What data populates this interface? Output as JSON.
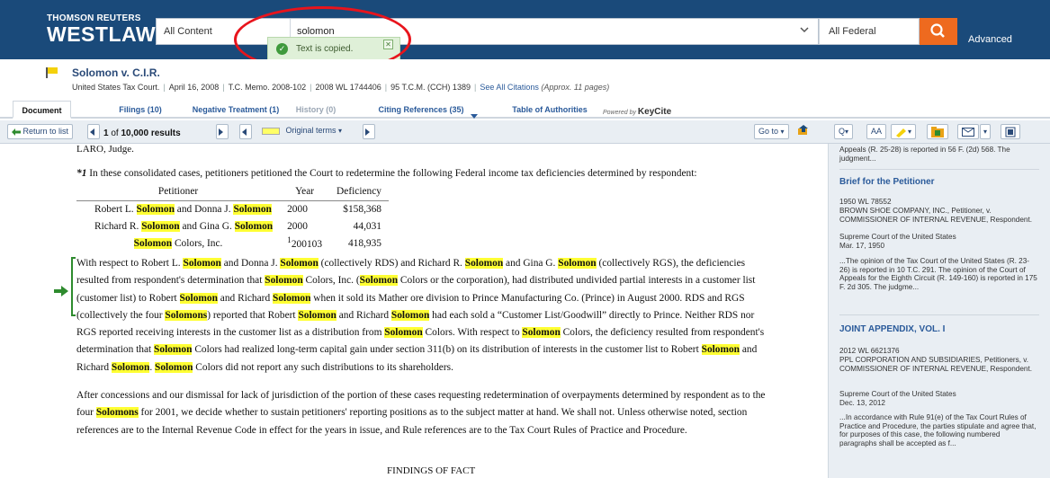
{
  "header": {
    "brand_top": "THOMSON REUTERS",
    "brand_main": "WESTLAW",
    "content_scope": "All Content",
    "query": "solomon",
    "jurisdiction": "All Federal",
    "advanced_label": "Advanced",
    "search_icon": "search-icon",
    "colors": {
      "bar": "#1a4a7a",
      "search_button": "#ee6a1f"
    }
  },
  "toast": {
    "message": "Text is copied.",
    "close_label": "✕"
  },
  "document_info": {
    "title": "Solomon v. C.I.R.",
    "court": "United States Tax Court.",
    "date": "April 16, 2008",
    "memo": "T.C. Memo. 2008-102",
    "wl": "2008 WL 1744406",
    "tcm": "95 T.C.M. (CCH) 1389",
    "see_all": "See All Citations",
    "approx": "(Approx. 11 pages)"
  },
  "tabs": [
    {
      "label": "Document"
    },
    {
      "label": "Filings (10)"
    },
    {
      "label": "Negative Treatment (1)"
    },
    {
      "label": "History (0)"
    },
    {
      "label": "Citing References (35)"
    },
    {
      "label": "Table of Authorities"
    }
  ],
  "powered_by": {
    "prefix": "Powered by",
    "brand": "KeyCite"
  },
  "toolbar": {
    "return_label": "Return to list",
    "results_prefix": "1",
    "results_middle": "of",
    "results_count": "10,000 results",
    "original_terms": "Original terms",
    "goto_label": "Go to",
    "aa_label": "AA"
  },
  "document": {
    "judge_line": "LARO, Judge.",
    "intro_star": "*1",
    "intro": " In these consolidated cases, petitioners petitioned the Court to redetermine the following Federal income tax deficiencies determined by respondent:",
    "table_headers": [
      "Petitioner",
      "Year",
      "Deficiency"
    ],
    "rows": [
      {
        "p1": "Robert L. ",
        "h1": "Solomon",
        "p2": " and Donna J. ",
        "h2": "Solomon",
        "year": "2000",
        "deficiency": "$158,368"
      },
      {
        "p1": "Richard R. ",
        "h1": "Solomon",
        "p2": " and Gina G. ",
        "h2": "Solomon",
        "year": "2000",
        "deficiency": "44,031"
      },
      {
        "p1": "",
        "h1": "Solomon",
        "p2": " Colors, Inc.",
        "h2": "",
        "year_sup": "1",
        "year": "200103",
        "deficiency": "418,935"
      }
    ],
    "para1": [
      "With respect to Robert L. ",
      "Solomon",
      " and Donna J. ",
      "Solomon",
      " (collectively RDS) and Richard R. ",
      "Solomon",
      " and Gina G. ",
      "Solomon",
      " (collectively RGS), the deficiencies resulted from respondent's determination that ",
      "Solomon",
      " Colors, Inc. (",
      "Solomon",
      " Colors or the corporation), had distributed undivided partial interests in a customer list (customer list) to Robert ",
      "Solomon",
      " and Richard ",
      "Solomon",
      " when it sold its Mather ore division to Prince Manufacturing Co. (Prince) in August 2000. RDS and RGS (collectively the four ",
      "Solomons",
      ") reported that Robert ",
      "Solomon",
      " and Richard ",
      "Solomon",
      " had each sold a “Customer List/Goodwill” directly to Prince. Neither RDS nor RGS reported receiving interests in the customer list as a distribution from ",
      "Solomon",
      " Colors. With respect to ",
      "Solomon",
      " Colors, the deficiency resulted from respondent's determination that ",
      "Solomon",
      " Colors had realized long-term capital gain under section 311(b) on its distribution of interests in the customer list to Robert ",
      "Solomon",
      " and Richard ",
      "Solomon",
      ". ",
      "Solomon",
      " Colors did not report any such distributions to its shareholders."
    ],
    "para2": [
      "After concessions and our dismissal for lack of jurisdiction of the portion of these cases requesting redetermination of overpayments determined by respondent as to the four ",
      "Solomons",
      " for 2001, we decide whether to sustain petitioners' reporting positions as to the subject matter at hand. We shall not. Unless otherwise noted, section references are to the Internal Revenue Code in effect for the years in issue, and Rule references are to the Tax Court Rules of Practice and Procedure."
    ],
    "findings": "FINDINGS OF FACT"
  },
  "sidebar": {
    "top_snippet": "Appeals (R. 25-28) is reported in 56 F. (2d) 568. The judgment...",
    "items": [
      {
        "title": "Brief for the Petitioner",
        "cite": "1950 WL 78552",
        "parties": "BROWN SHOE COMPANY, INC., Petitioner, v. COMMISSIONER OF INTERNAL REVENUE, Respondent.",
        "court": "Supreme Court of the United States",
        "date": "Mar. 17, 1950",
        "snippet": "...The opinion of the Tax Court of the United States (R. 23-26) is reported in 10 T.C. 291. The opinion of the Court of Appeals for the Eighth Circuit (R. 149-160) is reported in 175 F. 2d 305. The judgme..."
      },
      {
        "title": "JOINT APPENDIX, VOL. I",
        "cite": "2012 WL 6621376",
        "parties": "PPL CORPORATION AND SUBSIDIARIES, Petitioners, v. COMMISSIONER OF INTERNAL REVENUE, Respondent.",
        "court": "Supreme Court of the United States",
        "date": "Dec. 13, 2012",
        "snippet": "...In accordance with Rule 91(e) of the Tax Court Rules of Practice and Procedure, the parties stipulate and agree that, for purposes of this case, the following numbered paragraphs shall be accepted as f..."
      }
    ]
  }
}
